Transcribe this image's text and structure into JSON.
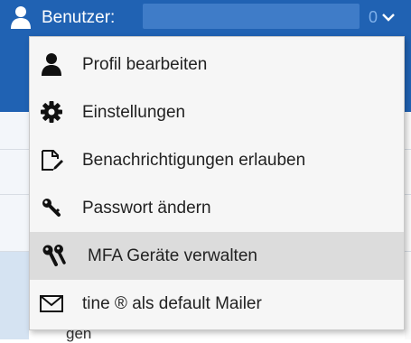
{
  "header": {
    "user_label": "Benutzer:",
    "user_value_suffix": "0",
    "user_icon": "user-icon",
    "chevron_icon": "chevron-down-icon"
  },
  "colors": {
    "header_bg": "#2062b3",
    "menu_bg": "#f6f6f6",
    "menu_active_bg": "#dcdcdc",
    "text": "#222222"
  },
  "menu": {
    "items": [
      {
        "label": "Profil bearbeiten",
        "icon": "user-icon"
      },
      {
        "label": "Einstellungen",
        "icon": "gear-icon"
      },
      {
        "label": "Benachrichtigungen erlauben",
        "icon": "notification-edit-icon"
      },
      {
        "label": "Passwort ändern",
        "icon": "key-icon"
      },
      {
        "label": "MFA Geräte verwalten",
        "icon": "keys-icon",
        "active": true
      },
      {
        "label": "tine ® als default Mailer",
        "icon": "envelope-icon"
      }
    ]
  },
  "background": {
    "partial_text": "gen"
  }
}
